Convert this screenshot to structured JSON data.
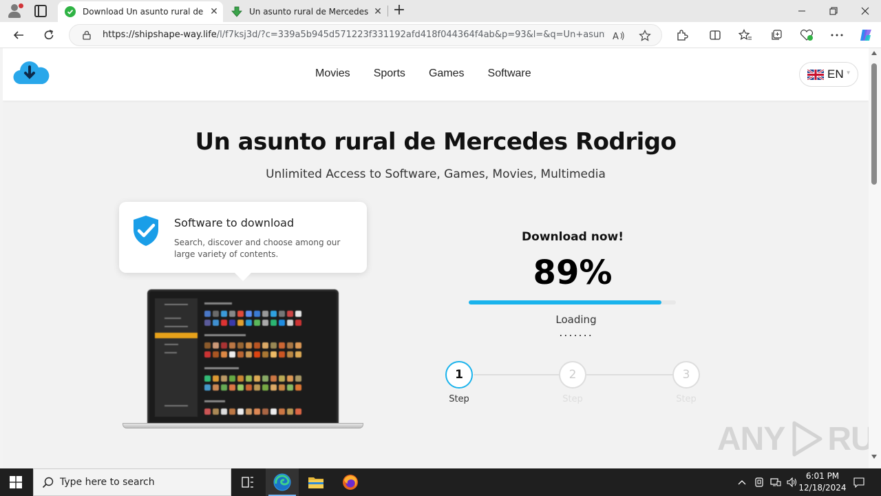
{
  "browser": {
    "tabs": [
      {
        "title": "Download Un asunto rural de Mercedes Rodrigo",
        "active": true
      },
      {
        "title": "Un asunto rural de Mercedes Rodrigo",
        "active": false
      }
    ],
    "url_host": "https://shipshape-way.life",
    "url_path": "/l/f7ksj3d/?c=339a5b945d571223f331192afd418f044364f4ab&p=93&l=&q=Un+asunto+rural+de+Mercedes+Rodrigo"
  },
  "site": {
    "menu": [
      "Movies",
      "Sports",
      "Games",
      "Software"
    ],
    "language": "EN",
    "title": "Un asunto rural de Mercedes Rodrigo",
    "subtitle": "Unlimited Access to Software, Games, Movies, Multimedia",
    "card": {
      "title": "Software to download",
      "description": "Search, discover and choose among our large variety of contents."
    },
    "download": {
      "title": "Download now!",
      "percent_label": "89%",
      "progress": 0.93,
      "loading": "Loading",
      "dots": "......."
    },
    "steps": [
      {
        "number": "1",
        "label": "Step",
        "active": true
      },
      {
        "number": "2",
        "label": "Step",
        "active": false
      },
      {
        "number": "3",
        "label": "Step",
        "active": false
      }
    ],
    "watermark": {
      "left": "ANY",
      "right": "RUN"
    }
  },
  "taskbar": {
    "search_placeholder": "Type here to search",
    "time": "6:01 PM",
    "date": "12/18/2024"
  },
  "colors": {
    "accent": "#1ab3ec",
    "shield": "#1a9ee8"
  }
}
